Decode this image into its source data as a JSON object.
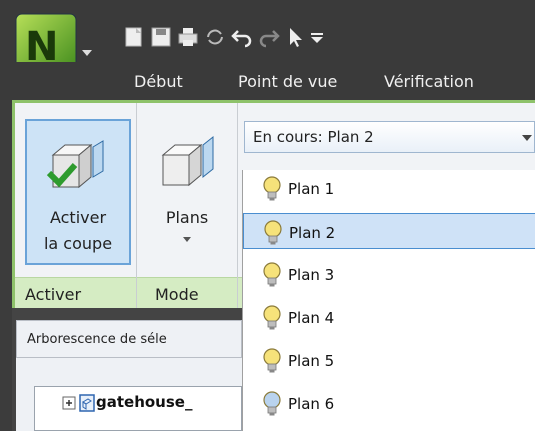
{
  "quick_access": {
    "icons": [
      "new-document-icon",
      "save-icon",
      "print-icon",
      "refresh-icon",
      "undo-icon",
      "redo-icon",
      "select-icon",
      "customize-dropdown-icon"
    ]
  },
  "tabs": [
    "Début",
    "Point de vue",
    "Vérification"
  ],
  "ribbon": {
    "buttons": {
      "activer_line1": "Activer",
      "activer_line2": "la coupe",
      "plans": "Plans"
    },
    "groups": [
      "Activer",
      "Mode"
    ],
    "dropdown_current": "En cours: Plan 2"
  },
  "planes": [
    {
      "label": "Plan 1",
      "selected": false,
      "bulb": "on"
    },
    {
      "label": "Plan 2",
      "selected": true,
      "bulb": "on"
    },
    {
      "label": "Plan 3",
      "selected": false,
      "bulb": "on"
    },
    {
      "label": "Plan 4",
      "selected": false,
      "bulb": "on"
    },
    {
      "label": "Plan 5",
      "selected": false,
      "bulb": "on"
    },
    {
      "label": "Plan 6",
      "selected": false,
      "bulb": "off"
    }
  ],
  "panel": {
    "title": "Arborescence de séle",
    "tree_item": "gatehouse_"
  },
  "colors": {
    "ribbon_accent": "#8ec26a",
    "selection": "#cfe2f7",
    "bulb_on": "#f6e27a",
    "bulb_off": "#b9d3ee"
  }
}
